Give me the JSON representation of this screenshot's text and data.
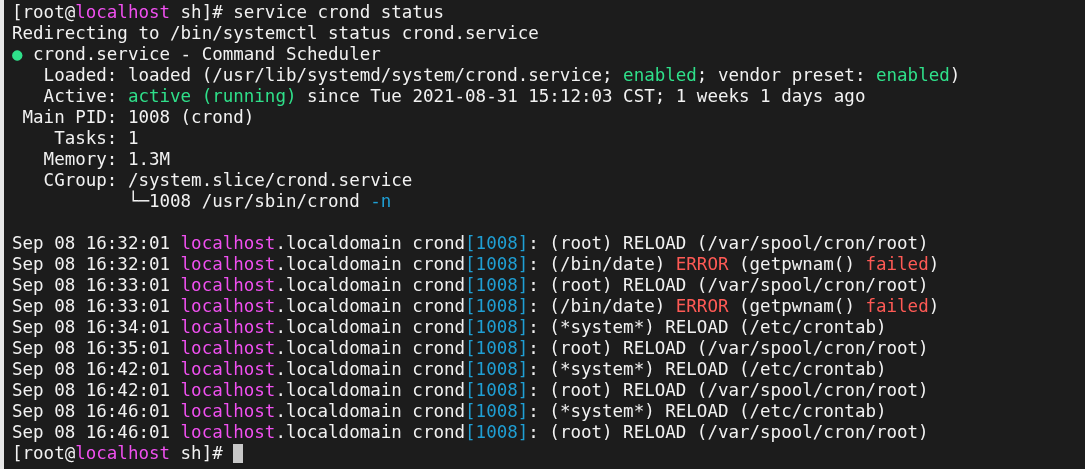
{
  "terminal": {
    "status_lines": [
      {
        "segments": [
          {
            "text": "[root@",
            "kind": "plain"
          },
          {
            "text": "localhost",
            "kind": "host"
          },
          {
            "text": " sh]# service crond status",
            "kind": "plain"
          }
        ]
      },
      {
        "segments": [
          {
            "text": "Redirecting to /bin/systemctl status crond.service",
            "kind": "plain"
          }
        ]
      },
      {
        "segments": [
          {
            "text": "●",
            "kind": "ok"
          },
          {
            "text": " crond.service - Command Scheduler",
            "kind": "plain"
          }
        ]
      },
      {
        "segments": [
          {
            "text": "   Loaded: loaded (/usr/lib/systemd/system/crond.service; ",
            "kind": "plain"
          },
          {
            "text": "enabled",
            "kind": "ok"
          },
          {
            "text": "; vendor preset: ",
            "kind": "plain"
          },
          {
            "text": "enabled",
            "kind": "ok"
          },
          {
            "text": ")",
            "kind": "plain"
          }
        ]
      },
      {
        "segments": [
          {
            "text": "   Active: ",
            "kind": "plain"
          },
          {
            "text": "active (running)",
            "kind": "ok"
          },
          {
            "text": " since Tue 2021-08-31 15:12:03 CST; 1 weeks 1 days ago",
            "kind": "plain"
          }
        ]
      },
      {
        "segments": [
          {
            "text": " Main PID: 1008 (crond)",
            "kind": "plain"
          }
        ]
      },
      {
        "segments": [
          {
            "text": "    Tasks: 1",
            "kind": "plain"
          }
        ]
      },
      {
        "segments": [
          {
            "text": "   Memory: 1.3M",
            "kind": "plain"
          }
        ]
      },
      {
        "segments": [
          {
            "text": "   CGroup: /system.slice/crond.service",
            "kind": "plain"
          }
        ]
      },
      {
        "segments": [
          {
            "text": "           └─1008 /usr/sbin/crond ",
            "kind": "plain"
          },
          {
            "text": "-n",
            "kind": "pid"
          }
        ]
      }
    ],
    "log_lines": [
      {
        "segments": [
          {
            "text": "Sep 08 16:32:01 ",
            "kind": "plain"
          },
          {
            "text": "localhost",
            "kind": "host"
          },
          {
            "text": ".localdomain crond",
            "kind": "plain"
          },
          {
            "text": "[1008]",
            "kind": "pid"
          },
          {
            "text": ": (root) RELOAD (/var/spool/cron/root)",
            "kind": "plain"
          }
        ]
      },
      {
        "segments": [
          {
            "text": "Sep 08 16:32:01 ",
            "kind": "plain"
          },
          {
            "text": "localhost",
            "kind": "host"
          },
          {
            "text": ".localdomain crond",
            "kind": "plain"
          },
          {
            "text": "[1008]",
            "kind": "pid"
          },
          {
            "text": ": (/bin/date) ",
            "kind": "plain"
          },
          {
            "text": "ERROR",
            "kind": "error"
          },
          {
            "text": " (getpwnam() ",
            "kind": "plain"
          },
          {
            "text": "failed",
            "kind": "error"
          },
          {
            "text": ")",
            "kind": "plain"
          }
        ]
      },
      {
        "segments": [
          {
            "text": "Sep 08 16:33:01 ",
            "kind": "plain"
          },
          {
            "text": "localhost",
            "kind": "host"
          },
          {
            "text": ".localdomain crond",
            "kind": "plain"
          },
          {
            "text": "[1008]",
            "kind": "pid"
          },
          {
            "text": ": (root) RELOAD (/var/spool/cron/root)",
            "kind": "plain"
          }
        ]
      },
      {
        "segments": [
          {
            "text": "Sep 08 16:33:01 ",
            "kind": "plain"
          },
          {
            "text": "localhost",
            "kind": "host"
          },
          {
            "text": ".localdomain crond",
            "kind": "plain"
          },
          {
            "text": "[1008]",
            "kind": "pid"
          },
          {
            "text": ": (/bin/date) ",
            "kind": "plain"
          },
          {
            "text": "ERROR",
            "kind": "error"
          },
          {
            "text": " (getpwnam() ",
            "kind": "plain"
          },
          {
            "text": "failed",
            "kind": "error"
          },
          {
            "text": ")",
            "kind": "plain"
          }
        ]
      },
      {
        "segments": [
          {
            "text": "Sep 08 16:34:01 ",
            "kind": "plain"
          },
          {
            "text": "localhost",
            "kind": "host"
          },
          {
            "text": ".localdomain crond",
            "kind": "plain"
          },
          {
            "text": "[1008]",
            "kind": "pid"
          },
          {
            "text": ": (*system*) RELOAD (/etc/crontab)",
            "kind": "plain"
          }
        ]
      },
      {
        "segments": [
          {
            "text": "Sep 08 16:35:01 ",
            "kind": "plain"
          },
          {
            "text": "localhost",
            "kind": "host"
          },
          {
            "text": ".localdomain crond",
            "kind": "plain"
          },
          {
            "text": "[1008]",
            "kind": "pid"
          },
          {
            "text": ": (root) RELOAD (/var/spool/cron/root)",
            "kind": "plain"
          }
        ]
      },
      {
        "segments": [
          {
            "text": "Sep 08 16:42:01 ",
            "kind": "plain"
          },
          {
            "text": "localhost",
            "kind": "host"
          },
          {
            "text": ".localdomain crond",
            "kind": "plain"
          },
          {
            "text": "[1008]",
            "kind": "pid"
          },
          {
            "text": ": (*system*) RELOAD (/etc/crontab)",
            "kind": "plain"
          }
        ]
      },
      {
        "segments": [
          {
            "text": "Sep 08 16:42:01 ",
            "kind": "plain"
          },
          {
            "text": "localhost",
            "kind": "host"
          },
          {
            "text": ".localdomain crond",
            "kind": "plain"
          },
          {
            "text": "[1008]",
            "kind": "pid"
          },
          {
            "text": ": (root) RELOAD (/var/spool/cron/root)",
            "kind": "plain"
          }
        ]
      },
      {
        "segments": [
          {
            "text": "Sep 08 16:46:01 ",
            "kind": "plain"
          },
          {
            "text": "localhost",
            "kind": "host"
          },
          {
            "text": ".localdomain crond",
            "kind": "plain"
          },
          {
            "text": "[1008]",
            "kind": "pid"
          },
          {
            "text": ": (*system*) RELOAD (/etc/crontab)",
            "kind": "plain"
          }
        ]
      },
      {
        "segments": [
          {
            "text": "Sep 08 16:46:01 ",
            "kind": "plain"
          },
          {
            "text": "localhost",
            "kind": "host"
          },
          {
            "text": ".localdomain crond",
            "kind": "plain"
          },
          {
            "text": "[1008]",
            "kind": "pid"
          },
          {
            "text": ": (root) RELOAD (/var/spool/cron/root)",
            "kind": "plain"
          }
        ]
      }
    ],
    "final_prompt": {
      "segments": [
        {
          "text": "[root@",
          "kind": "plain"
        },
        {
          "text": "localhost",
          "kind": "host"
        },
        {
          "text": " sh]#",
          "kind": "plain"
        }
      ]
    }
  }
}
